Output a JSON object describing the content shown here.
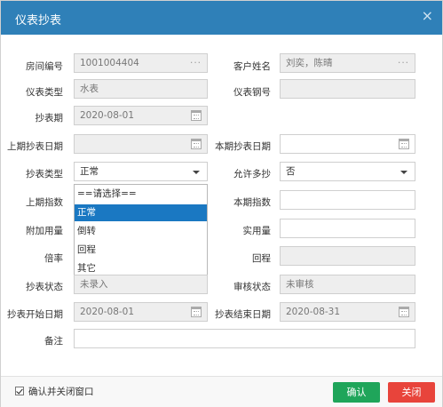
{
  "dialog": {
    "title": "仪表抄表",
    "close_glyph": "×"
  },
  "form": {
    "room_no": {
      "label": "房间编号",
      "value": "1001004404",
      "dots": "···"
    },
    "customer": {
      "label": "客户姓名",
      "value": "刘奕，陈晴",
      "dots": "···"
    },
    "meter_type": {
      "label": "仪表类型",
      "value": "水表"
    },
    "meter_no": {
      "label": "仪表钢号",
      "value": ""
    },
    "period": {
      "label": "抄表期",
      "value": "2020-08-01"
    },
    "last_date": {
      "label": "上期抄表日期",
      "value": ""
    },
    "this_date": {
      "label": "本期抄表日期",
      "value": ""
    },
    "read_type": {
      "label": "抄表类型",
      "value": "正常"
    },
    "allow_multi": {
      "label": "允许多抄",
      "value": "否"
    },
    "last_reading": {
      "label": "上期指数"
    },
    "this_reading": {
      "label": "本期指数",
      "value": ""
    },
    "extra_usage": {
      "label": "附加用量"
    },
    "actual_usage": {
      "label": "实用量",
      "value": ""
    },
    "multiplier": {
      "label": "倍率"
    },
    "return_trip": {
      "label": "回程",
      "value": ""
    },
    "read_status": {
      "label": "抄表状态",
      "value": "未录入"
    },
    "audit_status": {
      "label": "审核状态",
      "value": "未审核"
    },
    "start_date": {
      "label": "抄表开始日期",
      "value": "2020-08-01"
    },
    "end_date": {
      "label": "抄表结束日期",
      "value": "2020-08-31"
    },
    "remark": {
      "label": "备注",
      "value": ""
    }
  },
  "dropdown": {
    "options": [
      "==请选择==",
      "正常",
      "倒转",
      "回程",
      "其它"
    ],
    "selected": "正常"
  },
  "footer": {
    "confirm_close_label": "确认并关闭窗口",
    "confirm_close_checked": true,
    "ok_label": "确认",
    "close_label": "关闭"
  },
  "colors": {
    "titlebar": "#2f80b8",
    "selected_option": "#1a78c2",
    "ok_button": "#1fa55a",
    "close_button": "#e8443b"
  }
}
